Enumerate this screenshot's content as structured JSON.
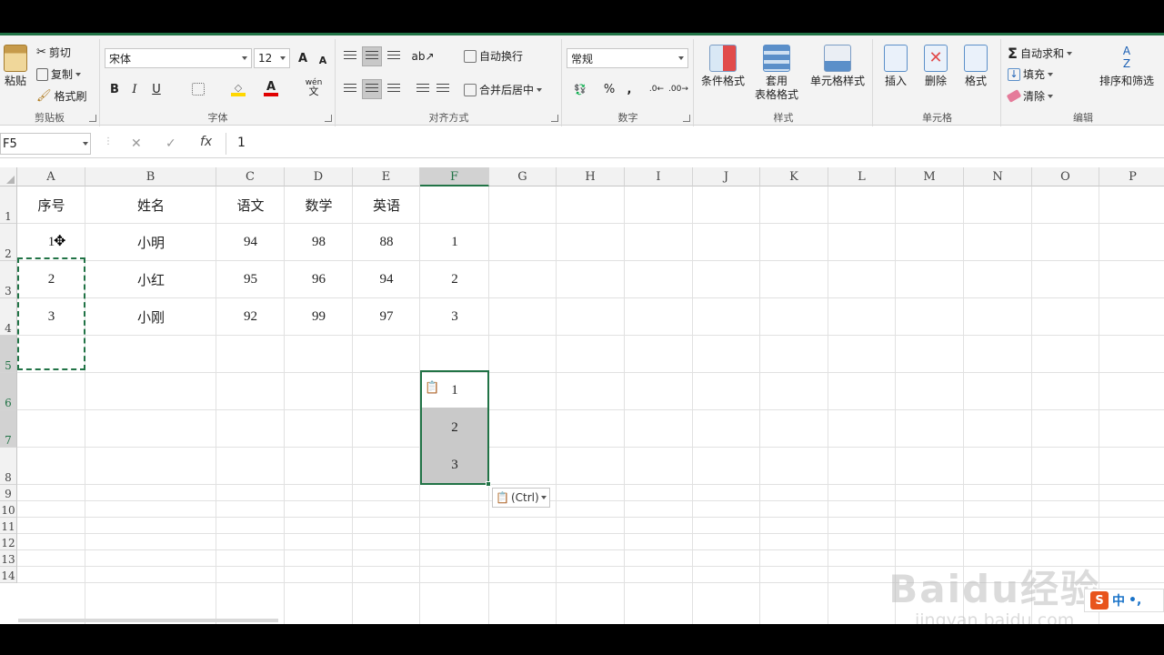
{
  "ribbon": {
    "clipboard": {
      "paste": "粘贴",
      "cut": "剪切",
      "copy": "复制",
      "format_painter": "格式刷",
      "label": "剪贴板"
    },
    "font": {
      "family": "宋体",
      "size": "12",
      "grow": "A",
      "shrink": "A",
      "bold": "B",
      "italic": "I",
      "underline": "U",
      "phonetic": "wén",
      "phonetic_sub": "文",
      "label": "字体"
    },
    "alignment": {
      "wrap_text": "自动换行",
      "merge_center": "合并后居中",
      "label": "对齐方式"
    },
    "number": {
      "format": "常规",
      "percent": "%",
      "comma": ",",
      "label": "数字"
    },
    "styles": {
      "conditional": "条件格式",
      "table_line1": "套用",
      "table_line2": "表格格式",
      "cell_styles": "单元格样式",
      "label": "样式"
    },
    "cells": {
      "insert": "插入",
      "delete": "删除",
      "format": "格式",
      "label": "单元格"
    },
    "editing": {
      "autosum": "自动求和",
      "fill": "填充",
      "clear": "清除",
      "sort_filter": "排序和筛选",
      "label": "编辑"
    }
  },
  "formula_bar": {
    "name_box": "F5",
    "cancel": "✕",
    "enter": "✓",
    "fx": "fx",
    "value": "1"
  },
  "columns": [
    "A",
    "B",
    "C",
    "D",
    "E",
    "F",
    "G",
    "H",
    "I",
    "J",
    "K",
    "L",
    "M",
    "N",
    "O",
    "P"
  ],
  "rows": [
    "1",
    "2",
    "3",
    "4",
    "5",
    "6",
    "7",
    "8",
    "9",
    "10",
    "11",
    "12",
    "13",
    "14"
  ],
  "table": {
    "headers": [
      "序号",
      "姓名",
      "语文",
      "数学",
      "英语"
    ],
    "data": [
      [
        "1",
        "小明",
        "94",
        "98",
        "88",
        "1"
      ],
      [
        "2",
        "小红",
        "95",
        "96",
        "94",
        "2"
      ],
      [
        "3",
        "小刚",
        "92",
        "99",
        "97",
        "3"
      ]
    ],
    "pasted": [
      "1",
      "2",
      "3"
    ]
  },
  "paste_options": {
    "label": "(Ctrl)"
  },
  "watermark": {
    "main": "Baidu经验",
    "sub": "jingyan.baidu.com"
  },
  "ime": {
    "logo": "S",
    "mode": "中",
    "punct": "•,"
  },
  "colors": {
    "accent": "#217346",
    "selection_shade": "#c9c9c9"
  }
}
